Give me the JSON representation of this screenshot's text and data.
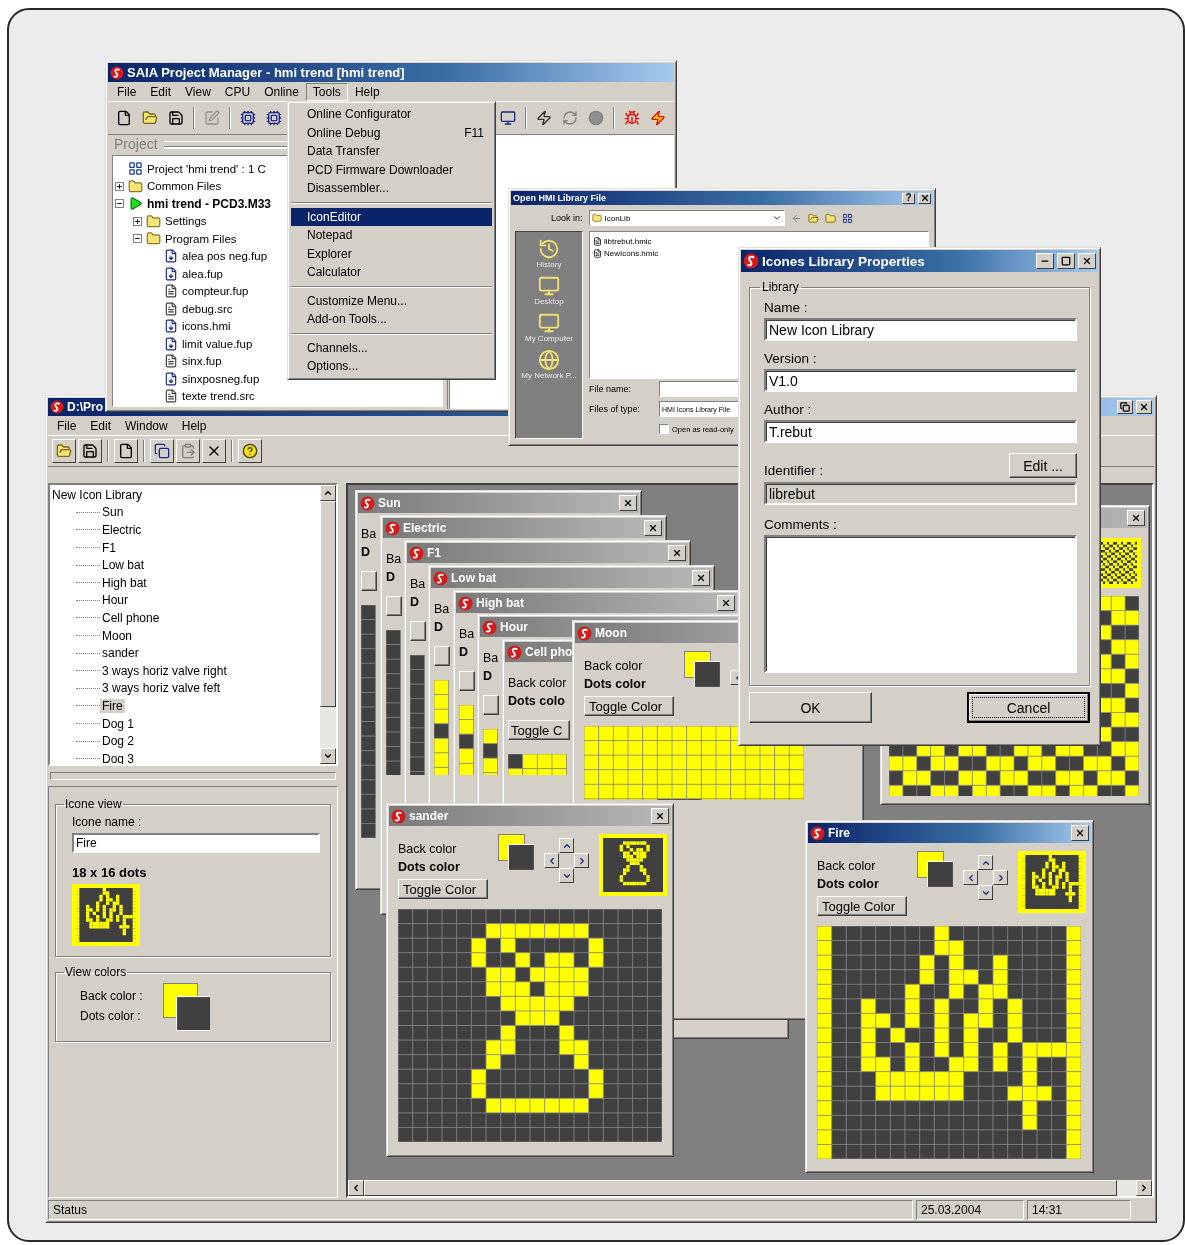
{
  "project_manager": {
    "title": "SAIA Project Manager - hmi trend [hmi trend]",
    "menu": [
      {
        "label": "File",
        "selected": false
      },
      {
        "label": "Edit",
        "selected": false
      },
      {
        "label": "View",
        "selected": false
      },
      {
        "label": "CPU",
        "selected": false
      },
      {
        "label": "Online",
        "selected": false
      },
      {
        "label": "Tools",
        "selected": true
      },
      {
        "label": "Help",
        "selected": false
      }
    ],
    "pane_title": "Project",
    "tree": [
      {
        "kind": "project",
        "label": "Project 'hmi trend' : 1 C"
      },
      {
        "kind": "folder",
        "label": "Common Files",
        "expanded": false
      },
      {
        "kind": "device",
        "label": "hmi trend - PCD3.M33",
        "expanded": true,
        "children": [
          {
            "kind": "folder",
            "label": "Settings",
            "expanded": false
          },
          {
            "kind": "folder",
            "label": "Program Files",
            "expanded": true,
            "children": [
              {
                "kind": "program",
                "label": "alea pos neg.fup"
              },
              {
                "kind": "program",
                "label": "alea.fup"
              },
              {
                "kind": "source",
                "label": "compteur.fup"
              },
              {
                "kind": "source",
                "label": "debug.src"
              },
              {
                "kind": "program",
                "label": "icons.hmi"
              },
              {
                "kind": "program",
                "label": "limit value.fup"
              },
              {
                "kind": "source",
                "label": "sinx.fup"
              },
              {
                "kind": "program",
                "label": "sinxposneg.fup"
              },
              {
                "kind": "source",
                "label": "texte trend.src"
              }
            ]
          }
        ]
      }
    ],
    "tools_menu": [
      [
        {
          "label": "Online Configurator",
          "selected": false
        },
        {
          "label": "Online Debug",
          "shortcut": "F11",
          "selected": false
        },
        {
          "label": "Data Transfer",
          "selected": false
        },
        {
          "label": "PCD Firmware Downloader",
          "selected": false
        },
        {
          "label": "Disassembler...",
          "selected": false
        }
      ],
      [
        {
          "label": "IconEditor",
          "selected": true
        },
        {
          "label": "Notepad",
          "selected": false
        },
        {
          "label": "Explorer",
          "selected": false
        },
        {
          "label": "Calculator",
          "selected": false
        }
      ],
      [
        {
          "label": "Customize Menu...",
          "selected": false
        },
        {
          "label": "Add-on Tools...",
          "selected": false
        }
      ],
      [
        {
          "label": "Channels...",
          "selected": false
        },
        {
          "label": "Options...",
          "selected": false
        }
      ]
    ]
  },
  "open_dialog": {
    "title": "Open HMI Library File",
    "help_button": "?",
    "look_in_label": "Look in:",
    "look_in_value": "IconLib",
    "places": [
      "History",
      "Desktop",
      "My Computer",
      "My Network P..."
    ],
    "files": [
      "libtrebut.hmic",
      "NewIcons.hmic"
    ],
    "file_name_label": "File name:",
    "file_type_label": "Files of type:",
    "file_type_value": "HMI Icons Library File",
    "read_only_label": "Open as read-only",
    "read_only_checked": false
  },
  "icon_editor": {
    "title": "D:\\Pro",
    "menu": [
      "File",
      "Edit",
      "Window",
      "Help"
    ],
    "tree": {
      "root": "New Icon Library",
      "items": [
        {
          "label": "Sun",
          "selected": false
        },
        {
          "label": "Electric",
          "selected": false
        },
        {
          "label": "F1",
          "selected": false
        },
        {
          "label": "Low bat",
          "selected": false
        },
        {
          "label": "High bat",
          "selected": false
        },
        {
          "label": "Hour",
          "selected": false
        },
        {
          "label": "Cell phone",
          "selected": false
        },
        {
          "label": "Moon",
          "selected": false
        },
        {
          "label": "sander",
          "selected": false
        },
        {
          "label": "3 ways horiz valve right",
          "selected": false
        },
        {
          "label": "3 ways horiz valve feft",
          "selected": false
        },
        {
          "label": "Fire",
          "selected": true
        },
        {
          "label": "Dog 1",
          "selected": false
        },
        {
          "label": "Dog 2",
          "selected": false
        },
        {
          "label": "Dog 3",
          "selected": false
        }
      ]
    },
    "icon_view": {
      "group_title": "Icone view",
      "name_label": "Icone name :",
      "name_value": "Fire",
      "size_text": "18 x 16 dots"
    },
    "view_colors": {
      "group_title": "View colors",
      "back_label": "Back color :",
      "dots_label": "Dots color :"
    },
    "icon_windows": [
      {
        "kind": "cascaded",
        "title": "Sun",
        "active": false,
        "back_label": "Ba",
        "dots_label": "D"
      },
      {
        "kind": "cascaded",
        "title": "Electric",
        "active": false,
        "back_label": "Ba",
        "dots_label": "D"
      },
      {
        "kind": "cascaded",
        "title": "F1",
        "active": false,
        "back_label": "Ba",
        "dots_label": "D"
      },
      {
        "kind": "cascaded",
        "title": "Low bat",
        "active": false,
        "back_label": "Ba",
        "dots_label": "D"
      },
      {
        "kind": "cascaded",
        "title": "High bat",
        "active": false,
        "back_label": "Ba",
        "dots_label": "D"
      },
      {
        "kind": "cascaded",
        "title": "Hour",
        "active": false,
        "back_label": "Ba",
        "dots_label": "D"
      },
      {
        "kind": "cascaded",
        "title": "Cell pho",
        "active": false,
        "back_label": "Back color",
        "dots_label": "Dots colo",
        "toggle_label": "Toggle C"
      },
      {
        "kind": "full",
        "title": "Moon",
        "active": false,
        "back_label": "Back color",
        "dots_label": "Dots color",
        "toggle_label": "Toggle Color"
      },
      {
        "kind": "full",
        "title": "sander",
        "active": false,
        "back_label": "Back color",
        "dots_label": "Dots color",
        "toggle_label": "Toggle Color"
      },
      {
        "kind": "full",
        "title": "Fire",
        "active": true,
        "back_label": "Back color",
        "dots_label": "Dots color",
        "toggle_label": "Toggle Color"
      }
    ],
    "status": {
      "text": "Status",
      "date": "25.03.2004",
      "time": "14:31"
    }
  },
  "properties_dialog": {
    "title": "Icones Library Properties",
    "group_title": "Library",
    "name_label": "Name :",
    "name_value": "New Icon Library",
    "version_label": "Version :",
    "version_value": "V1.0",
    "author_label": "Author :",
    "author_value": "T.rebut",
    "identifier_label": "Identifier :",
    "edit_button": "Edit ...",
    "identifier_value": "librebut",
    "comments_label": "Comments :",
    "buttons": [
      {
        "label": "OK",
        "focused": false
      },
      {
        "label": "Cancel",
        "focused": true
      }
    ]
  }
}
